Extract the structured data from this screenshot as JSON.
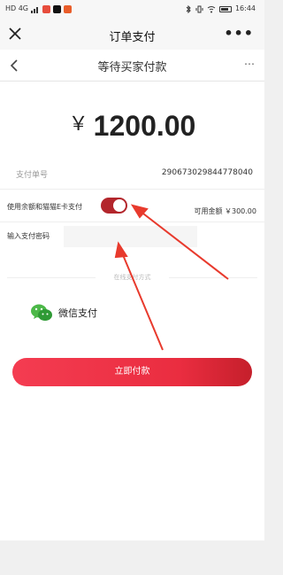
{
  "status_bar": {
    "left_text": "HD 4G",
    "time": "16:44",
    "app_icon_colors": [
      "#e74c3c",
      "#111111",
      "#e95d2a"
    ]
  },
  "navbar": {
    "title": "订单支付",
    "close_icon": "close-icon",
    "more_icon": "more-icon",
    "more_text": "•••"
  },
  "subbar": {
    "title": "等待买家付款",
    "back_icon": "chevron-left-icon",
    "more_text": "⋯"
  },
  "amount": {
    "currency": "￥",
    "value": "1200.00"
  },
  "order": {
    "label": "支付单号",
    "number": "290673029844778040"
  },
  "balance": {
    "label": "使用余额和猫猫E卡支付",
    "toggle_on": true,
    "available_text": "可用金额 ￥300.00"
  },
  "password": {
    "label": "输入支付密码",
    "value": "",
    "placeholder": ""
  },
  "payment_methods": {
    "section_title": "在线支付方式",
    "wechat_label": "微信支付",
    "wechat_icon": "wechat-icon"
  },
  "pay_button": {
    "label": "立即付款"
  },
  "colors": {
    "accent": "#ea2d40",
    "toggle": "#b3262c",
    "arrow": "#e83a2d"
  }
}
